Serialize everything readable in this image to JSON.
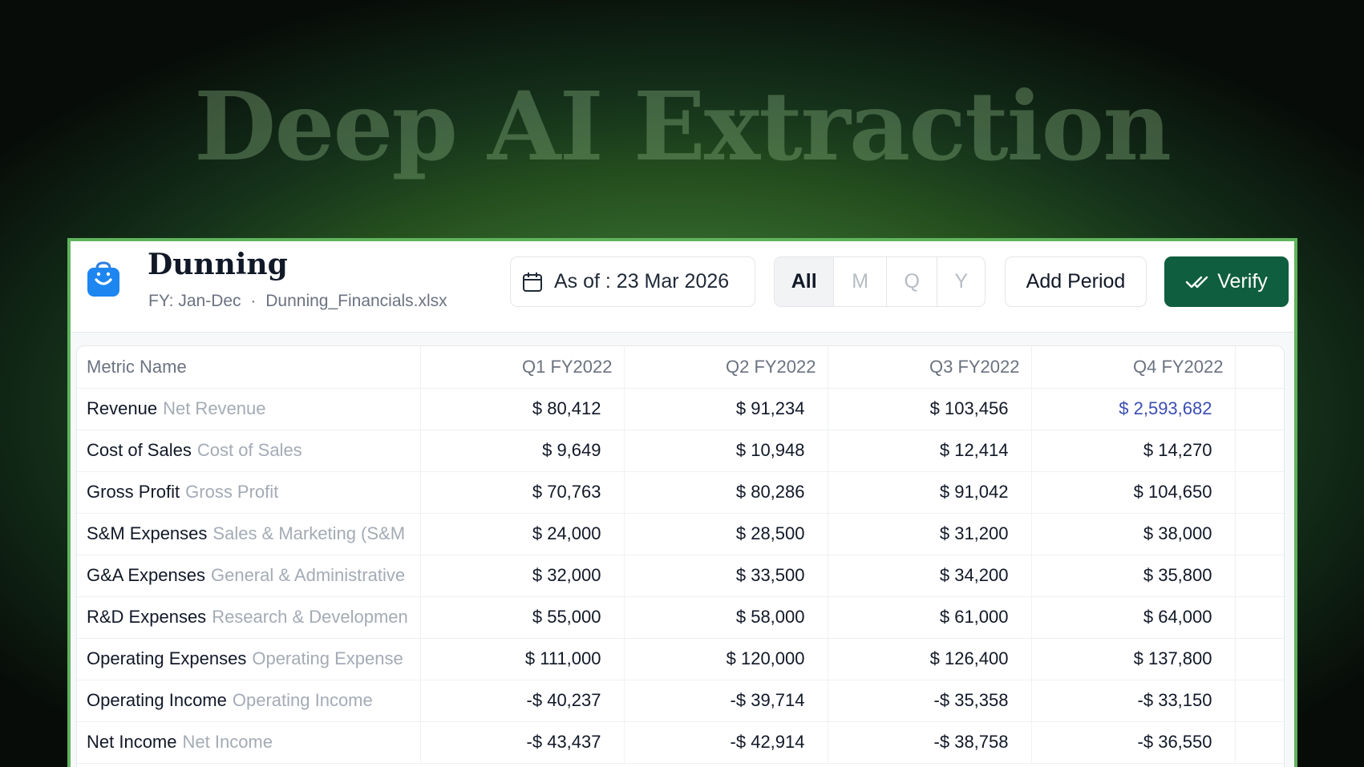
{
  "hero": {
    "title": "Deep AI Extraction"
  },
  "header": {
    "company": "Dunning",
    "fiscal_year": "FY: Jan-Dec",
    "separator": "·",
    "file_name": "Dunning_Financials.xlsx",
    "as_of_label": "As of : 23 Mar 2026",
    "period_filters": [
      "All",
      "M",
      "Q",
      "Y"
    ],
    "active_filter": "All",
    "add_period_label": "Add Period",
    "verify_label": "Verify"
  },
  "colors": {
    "accent_green": "#0f5e3f",
    "panel_border": "#5fb35c",
    "link_blue": "#3b4db3"
  },
  "icons": [
    "shopping-bag-icon",
    "calendar-icon",
    "double-check-icon"
  ],
  "table": {
    "columns": [
      "Metric Name",
      "Q1 FY2022",
      "Q2 FY2022",
      "Q3 FY2022",
      "Q4 FY2022"
    ],
    "rows": [
      {
        "name": "Revenue",
        "alias": "Net Revenue",
        "values": [
          "$ 80,412",
          "$ 91,234",
          "$ 103,456",
          "$ 2,593,682"
        ],
        "highlight": 3
      },
      {
        "name": "Cost of Sales",
        "alias": "Cost of Sales",
        "values": [
          "$ 9,649",
          "$ 10,948",
          "$ 12,414",
          "$ 14,270"
        ]
      },
      {
        "name": "Gross Profit",
        "alias": "Gross Profit",
        "values": [
          "$ 70,763",
          "$ 80,286",
          "$ 91,042",
          "$ 104,650"
        ]
      },
      {
        "name": "S&M Expenses",
        "alias": "Sales & Marketing (S&M",
        "values": [
          "$ 24,000",
          "$ 28,500",
          "$ 31,200",
          "$ 38,000"
        ]
      },
      {
        "name": "G&A Expenses",
        "alias": "General & Administrative",
        "values": [
          "$ 32,000",
          "$ 33,500",
          "$ 34,200",
          "$ 35,800"
        ]
      },
      {
        "name": "R&D Expenses",
        "alias": "Research & Developmen",
        "values": [
          "$ 55,000",
          "$ 58,000",
          "$ 61,000",
          "$ 64,000"
        ]
      },
      {
        "name": "Operating Expenses",
        "alias": "Operating Expense",
        "values": [
          "$ 111,000",
          "$ 120,000",
          "$ 126,400",
          "$ 137,800"
        ]
      },
      {
        "name": "Operating Income",
        "alias": "Operating Income",
        "values": [
          "-$ 40,237",
          "-$ 39,714",
          "-$ 35,358",
          "-$ 33,150"
        ]
      },
      {
        "name": "Net Income",
        "alias": "Net Income",
        "values": [
          "-$ 43,437",
          "-$ 42,914",
          "-$ 38,758",
          "-$ 36,550"
        ]
      }
    ]
  }
}
